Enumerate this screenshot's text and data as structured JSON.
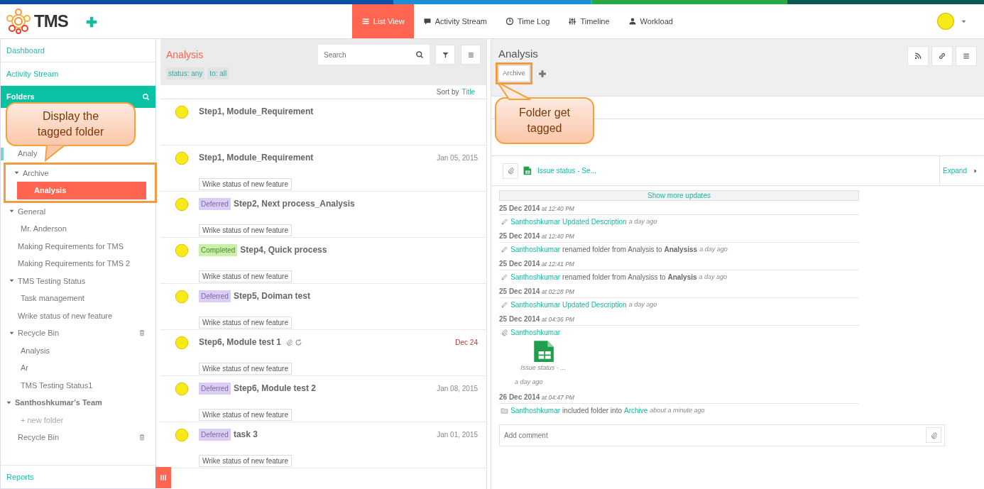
{
  "brand": {
    "name": "TMS"
  },
  "nav": [
    {
      "label": "List View",
      "selected": true
    },
    {
      "label": "Activity Stream",
      "selected": false
    },
    {
      "label": "Time Log",
      "selected": false
    },
    {
      "label": "Timeline",
      "selected": false
    },
    {
      "label": "Workload",
      "selected": false
    }
  ],
  "sidebar": {
    "links": [
      "Dashboard",
      "Activity Stream"
    ],
    "folders_header": "Folders",
    "tree": [
      {
        "label": "Analy",
        "kind": "folder",
        "current": true
      },
      {
        "label": "Archive",
        "kind": "folder",
        "expanded": true,
        "highlighted": true,
        "children": [
          {
            "label": "Analysis",
            "kind": "folder",
            "selected": true
          }
        ]
      },
      {
        "label": "General",
        "kind": "folder",
        "expanded": true,
        "children": [
          {
            "label": "Mr. Anderson",
            "kind": "folder",
            "selected": false
          }
        ]
      },
      {
        "label": "Making Requirements for TMS",
        "kind": "folder"
      },
      {
        "label": "Making Requirements for TMS 2",
        "kind": "folder"
      },
      {
        "label": "TMS Testing Status",
        "kind": "folder",
        "expanded": true,
        "children": [
          {
            "label": "Task management",
            "kind": "folder",
            "selected": false
          }
        ]
      },
      {
        "label": "Wrike status of new feature",
        "kind": "folder"
      },
      {
        "label": "Recycle Bin",
        "kind": "bin",
        "expanded": true,
        "children": [
          {
            "label": "Analysis",
            "kind": "folder",
            "selected": false
          },
          {
            "label": "Ar",
            "kind": "folder",
            "selected": false
          },
          {
            "label": "TMS Testing Status1",
            "kind": "folder",
            "selected": false
          }
        ]
      },
      {
        "label": "Santhoshkumar's Team",
        "kind": "team",
        "expanded": true,
        "children": [
          {
            "label": "+ new folder",
            "kind": "new"
          },
          {
            "label": "Recycle Bin",
            "kind": "bin"
          }
        ]
      }
    ],
    "footer": "Reports"
  },
  "list": {
    "title": "Analysis",
    "search": {
      "placeholder": "Search"
    },
    "filters": [
      "status: any",
      "to: all"
    ],
    "sort_label": "Sort by",
    "sort_value": "Title",
    "tasks": [
      {
        "title": "Step1, Module_Requirement"
      },
      {
        "title": "Step1, Module_Requirement",
        "date": "Jan 05, 2015",
        "tag": "Wrike status of new feature"
      },
      {
        "title": "Step2, Next process_Analysis",
        "status": {
          "label": "Deferred",
          "kind": "deferred"
        },
        "tag": "Wrike status of new feature"
      },
      {
        "title": "Step4, Quick process",
        "status": {
          "label": "Completed",
          "kind": "completed"
        },
        "tag": "Wrike status of new feature"
      },
      {
        "title": "Step5, Doiman test",
        "status": {
          "label": "Deferred",
          "kind": "deferred"
        },
        "tag": "Wrike status of new feature"
      },
      {
        "title": "Step6, Module test 1",
        "attachment": true,
        "recurring": true,
        "date": "Dec 24",
        "overdue": true,
        "tag": "Wrike status of new feature"
      },
      {
        "title": "Step6, Module test 2",
        "status": {
          "label": "Deferred",
          "kind": "deferred"
        },
        "date": "Jan 08, 2015",
        "tag": "Wrike status of new feature"
      },
      {
        "title": "task 3",
        "status": {
          "label": "Deferred",
          "kind": "deferred"
        },
        "date": "Jan 01, 2015",
        "tag": "Wrike status of new feature"
      }
    ]
  },
  "detail": {
    "title": "Analysis",
    "tags": [
      {
        "label": "Archive",
        "highlighted": true
      }
    ],
    "attachment": {
      "name": "Issue status - Se...",
      "expand": "Expand"
    },
    "show_more": "Show more updates",
    "updates": [
      {
        "date": "25 Dec 2014",
        "time": "at 12:40 PM",
        "kind": "edit",
        "user": "Santhoshkumar",
        "link": "Updated Description",
        "ago": "a day ago"
      },
      {
        "date": "25 Dec 2014",
        "time": "at 12:40 PM",
        "kind": "edit",
        "user": "Santhoshkumar",
        "text": "renamed folder from Analysis to **Analysiss**",
        "ago": "a day ago"
      },
      {
        "date": "25 Dec 2014",
        "time": "at 12:41 PM",
        "kind": "edit",
        "user": "Santhoshkumar",
        "text": "renamed folder from Analysiss to **Analysis**",
        "ago": "a day ago"
      },
      {
        "date": "25 Dec 2014",
        "time": "at 02:28 PM",
        "kind": "edit",
        "user": "Santhoshkumar",
        "link": "Updated Description",
        "ago": "a day ago"
      },
      {
        "date": "25 Dec 2014",
        "time": "at 04:36 PM",
        "kind": "attach",
        "user": "Santhoshkumar",
        "file": {
          "name": "Issue status - ...",
          "ago": "a day ago"
        }
      },
      {
        "date": "26 Dec 2014",
        "time": "at 04:47 PM",
        "kind": "folder",
        "user": "Santhoshkumar",
        "text": "included folder into",
        "link": "Archive",
        "ago": "about a minute ago"
      }
    ],
    "comment": {
      "placeholder": "Add comment"
    }
  },
  "callouts": [
    {
      "text": "Display the tagged folder"
    },
    {
      "text": "Folder get tagged"
    }
  ]
}
